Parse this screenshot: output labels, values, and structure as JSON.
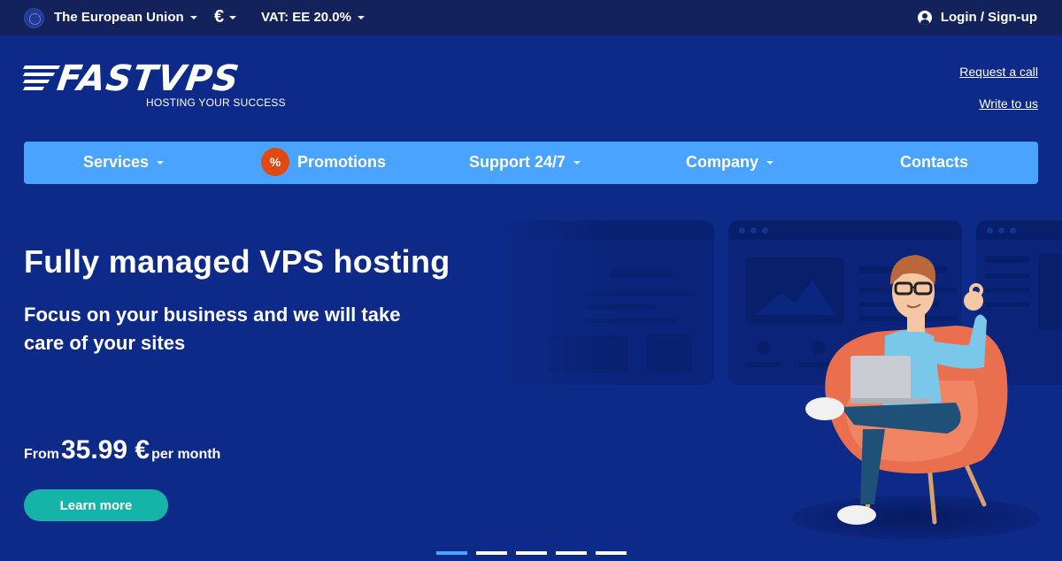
{
  "topbar": {
    "region": "The European Union",
    "currency": "€",
    "vat": "VAT: EE 20.0%",
    "login": "Login / Sign-up"
  },
  "brand": {
    "name": "FASTVPS",
    "tagline": "HOSTING YOUR SUCCESS"
  },
  "contact_links": {
    "request_call": "Request a call",
    "write_to_us": "Write to us"
  },
  "nav": {
    "items": [
      {
        "label": "Services",
        "has_dropdown": true
      },
      {
        "label": "Promotions",
        "badge": "%"
      },
      {
        "label": "Support 24/7",
        "has_dropdown": true
      },
      {
        "label": "Company",
        "has_dropdown": true
      },
      {
        "label": "Contacts"
      }
    ]
  },
  "hero": {
    "title": "Fully managed VPS hosting",
    "subtitle": "Focus on your business and we will take care of your sites",
    "price_prefix": "From",
    "price_amount": "35.99 €",
    "price_suffix": "per month",
    "cta": "Learn more"
  },
  "slider": {
    "count": 5,
    "active_index": 0
  },
  "colors": {
    "topbar_bg": "#13225a",
    "page_bg": "#0d2a88",
    "nav_bg": "#4aa3ff",
    "cta_bg": "#16b4a8",
    "promo_badge": "#e04a12"
  }
}
